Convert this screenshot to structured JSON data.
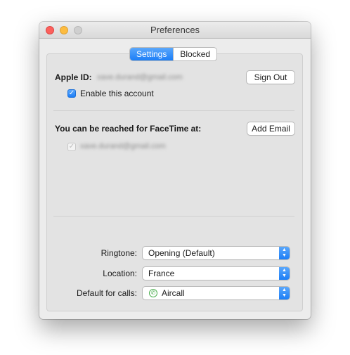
{
  "window": {
    "title": "Preferences"
  },
  "tabs": [
    {
      "label": "Settings",
      "active": true
    },
    {
      "label": "Blocked",
      "active": false
    }
  ],
  "account": {
    "apple_id_label": "Apple ID:",
    "apple_id_value": "xave.durand@gmail.com",
    "sign_out_label": "Sign Out",
    "enable_label": "Enable this account"
  },
  "facetime": {
    "reach_label": "You can be reached for FaceTime at:",
    "add_email_label": "Add Email",
    "email_value": "xave.durand@gmail.com"
  },
  "settings": {
    "ringtone_label": "Ringtone:",
    "ringtone_value": "Opening (Default)",
    "location_label": "Location:",
    "location_value": "France",
    "default_calls_label": "Default for calls:",
    "default_calls_value": "Aircall"
  },
  "colors": {
    "accent": "#1c7ef7",
    "close": "#fc605c",
    "minimize": "#fdbc40",
    "aircall": "#4caf50"
  },
  "icons": [
    "checkbox-check-icon",
    "chevron-updown-icon",
    "phone-icon"
  ]
}
